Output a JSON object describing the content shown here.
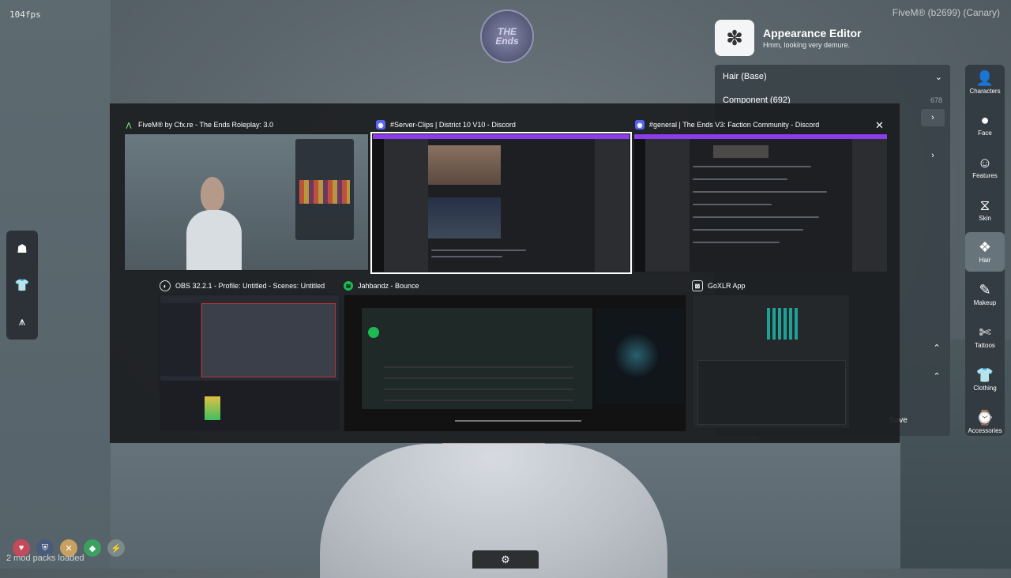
{
  "hud": {
    "fps": "104fps",
    "build": "FiveM® (b2699) (Canary)",
    "mods_loaded": "2 mod packs loaded",
    "server_logo_text": [
      "THE",
      "Ends"
    ]
  },
  "editor": {
    "title": "Appearance Editor",
    "subtitle": "Hmm, looking very demure.",
    "section": "Hair (Base)",
    "component_label": "Component (692)",
    "component_value": "678",
    "save_label": "Save"
  },
  "sidebar": [
    {
      "label": "Characters",
      "icon": "person-icon",
      "glyph": "👤"
    },
    {
      "label": "Face",
      "icon": "face-icon",
      "glyph": "●"
    },
    {
      "label": "Features",
      "icon": "features-icon",
      "glyph": "☺"
    },
    {
      "label": "Skin",
      "icon": "dna-icon",
      "glyph": "⧖"
    },
    {
      "label": "Hair",
      "icon": "hair-icon",
      "glyph": "❖"
    },
    {
      "label": "Makeup",
      "icon": "brush-icon",
      "glyph": "✎"
    },
    {
      "label": "Tattoos",
      "icon": "tattoo-icon",
      "glyph": "✄"
    },
    {
      "label": "Clothing",
      "icon": "shirt-icon",
      "glyph": "👕"
    },
    {
      "label": "Accessories",
      "icon": "watch-icon",
      "glyph": "⌚"
    }
  ],
  "switcher": {
    "windows": [
      {
        "title": "FiveM® by Cfx.re - The Ends Roleplay: 3.0",
        "icon": "fivem-icon",
        "icon_color": "#2a2a2a"
      },
      {
        "title": "#Server-Clips | District 10 V10 - Discord",
        "icon": "discord-icon",
        "icon_color": "#5865f2"
      },
      {
        "title": "#general | The Ends V3: Faction Community - Discord",
        "icon": "discord-icon",
        "icon_color": "#5865f2"
      },
      {
        "title": "OBS 32.2.1 - Profile: Untitled - Scenes: Untitled",
        "icon": "obs-icon",
        "icon_color": "#3b3f47"
      },
      {
        "title": "Jahbandz - Bounce",
        "icon": "spotify-icon",
        "icon_color": "#1db954"
      },
      {
        "title": "GoXLR App",
        "icon": "goxlr-icon",
        "icon_color": "#3a3d40"
      }
    ],
    "close_symbol": "✕"
  },
  "colors": {
    "discord_accent": "#8c3ce8",
    "spotify_green": "#1db954"
  }
}
